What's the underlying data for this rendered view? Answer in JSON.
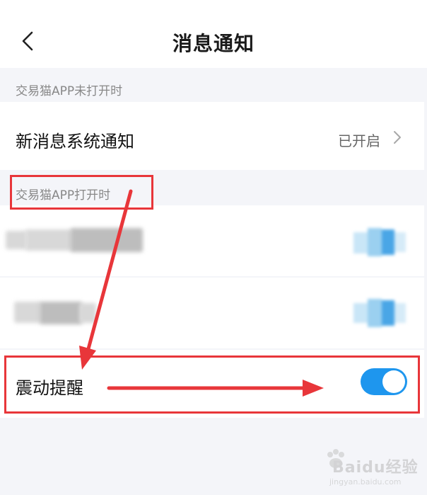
{
  "header": {
    "title": "消息通知",
    "back_icon": "chevron-left-icon"
  },
  "sections": [
    {
      "label": "交易猫APP未打开时"
    },
    {
      "label": "交易猫APP打开时"
    }
  ],
  "rows": {
    "new_message_notification": {
      "label": "新消息系统通知",
      "value": "已开启",
      "icon": "chevron-right-icon"
    },
    "vibration": {
      "label": "震动提醒",
      "toggle_on": true
    }
  },
  "colors": {
    "background": "#f4f5f9",
    "row_background": "#ffffff",
    "accent": "#1e96ee",
    "annotation_red": "#e8363a",
    "muted_text": "#888888"
  },
  "watermark": {
    "brand": "Baidu经验",
    "url": "jingyan.baidu.com"
  }
}
